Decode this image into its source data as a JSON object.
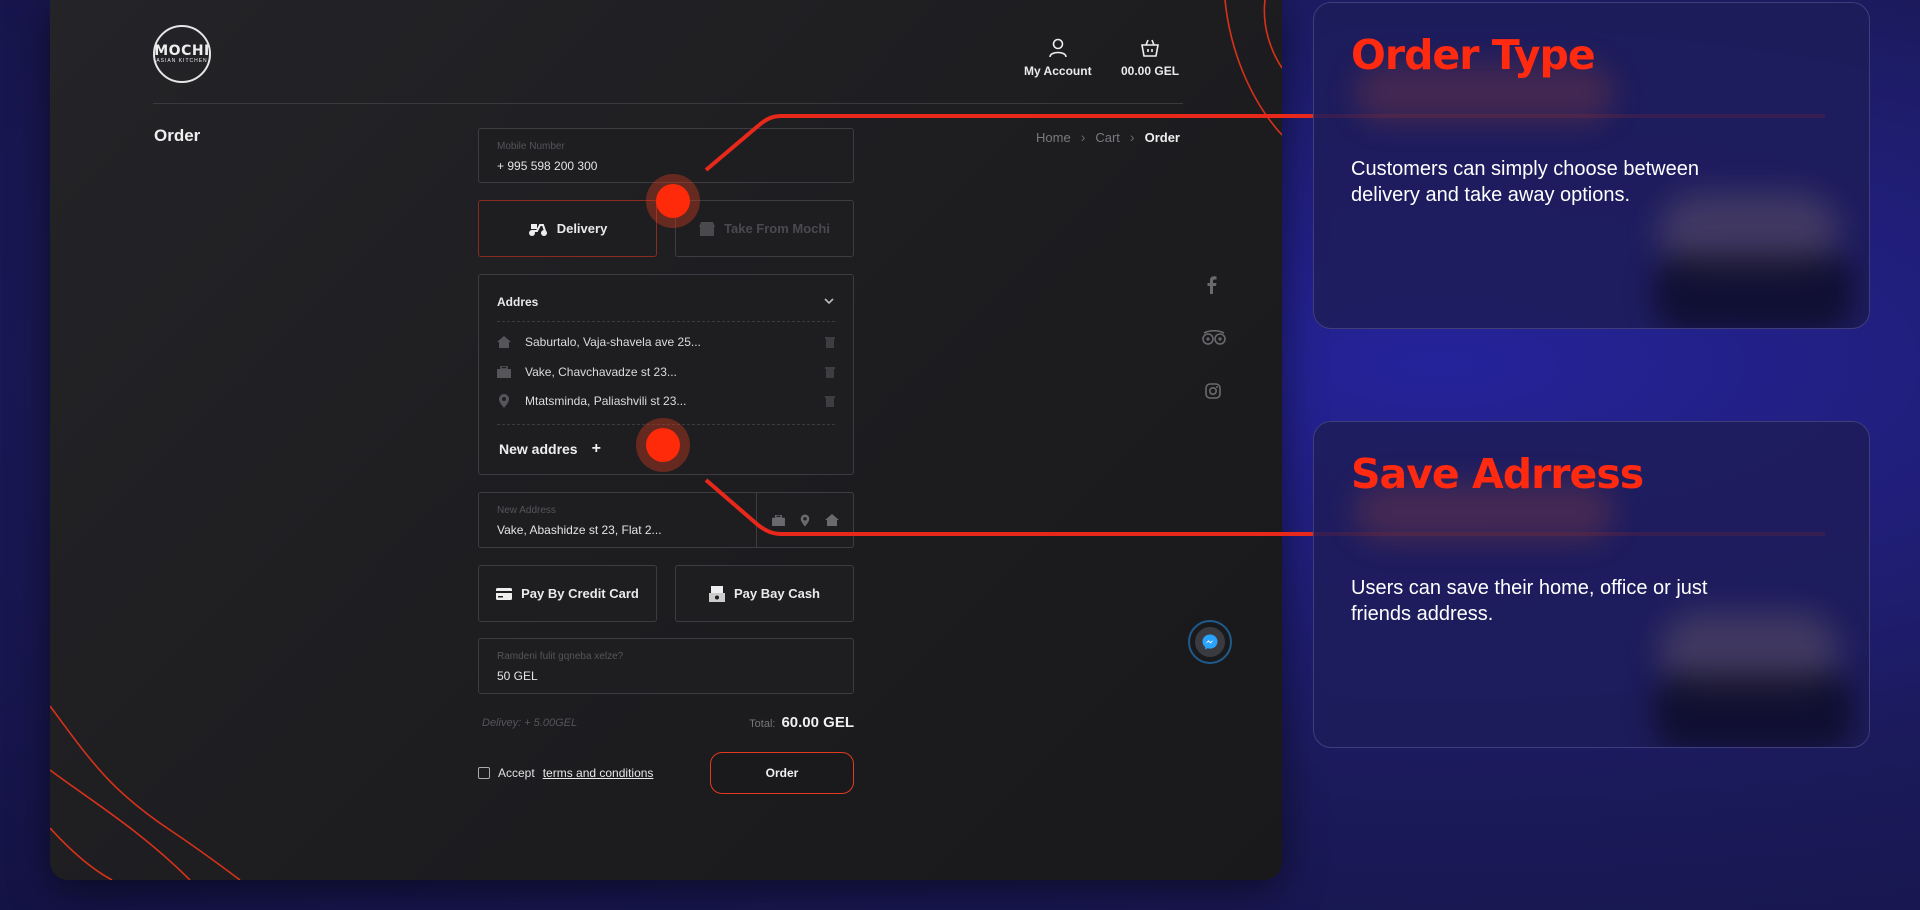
{
  "header": {
    "logo_text": "MOCHI",
    "logo_subtext": "ASIAN KITCHEN",
    "account_label": "My Account",
    "cart_total": "00.00 GEL"
  },
  "page_title": "Order",
  "breadcrumb": [
    "Home",
    "Cart",
    "Order"
  ],
  "form": {
    "mobile_label": "Mobile Number",
    "mobile_value": "+ 995 598 200 300",
    "delivery_label": "Delivery",
    "takeaway_label": "Take From Mochi",
    "address_header": "Addres",
    "addresses": [
      {
        "icon": "home-icon",
        "text": "Saburtalo, Vaja-shavela ave 25..."
      },
      {
        "icon": "briefcase-icon",
        "text": "Vake, Chavchavadze st 23..."
      },
      {
        "icon": "location-pin-icon",
        "text": "Mtatsminda, Paliashvili st 23..."
      }
    ],
    "new_address_button": "New addres",
    "new_address_label": "New Address",
    "new_address_value": "Vake, Abashidze st 23, Flat 2...",
    "pay_card_label": "Pay By Credit Card",
    "pay_cash_label": "Pay Bay Cash",
    "change_label": "Ramdeni fulit gqneba xelze?",
    "change_value": "50 GEL",
    "delivery_fee": "Delivey: + 5.00GEL",
    "total_label": "Total:",
    "total_value": "60.00 GEL",
    "accept_prefix": "Accept",
    "accept_link": "terms and conditions",
    "order_button": "Order"
  },
  "panels": [
    {
      "title": "Order Type",
      "text": "Customers can simply choose between delivery and take away options."
    },
    {
      "title": "Save Adrress",
      "text": "Users can save their home, office or just friends address."
    }
  ],
  "colors": {
    "accent": "#ff2a10",
    "background": "#1b1a5a",
    "app_bg": "#1e1e21"
  }
}
